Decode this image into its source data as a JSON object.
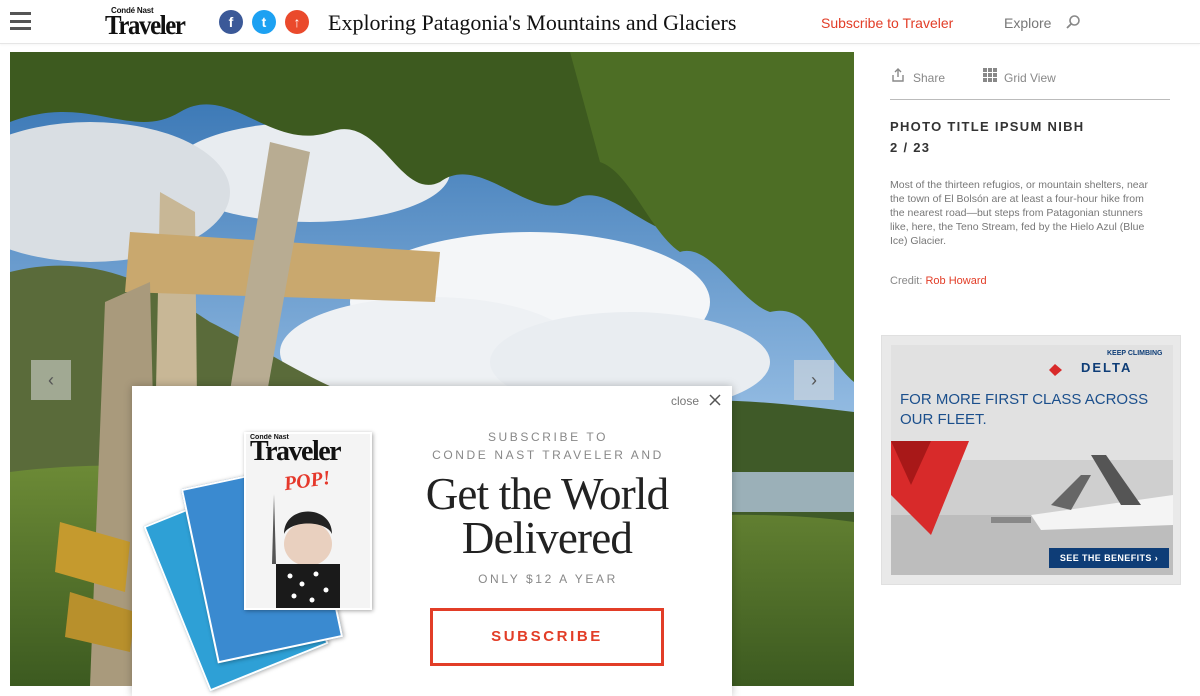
{
  "header": {
    "logo_small": "Condé Nast",
    "logo_big": "Traveler",
    "title": "Exploring Patagonia's Mountains and Glaciers",
    "subscribe_label": "Subscribe to Traveler",
    "explore_label": "Explore",
    "social": {
      "facebook": "f",
      "twitter": "t",
      "share": "↑"
    }
  },
  "gallery": {
    "prev_label": "‹",
    "next_label": "›"
  },
  "sidebar": {
    "share_label": "Share",
    "grid_label": "Grid View",
    "photo_title": "PHOTO TITLE IPSUM NIBH",
    "photo_count": "2 / 23",
    "caption": "Most of the thirteen refugios, or mountain shelters, near the town of El Bolsón are at least a four-hour hike from the nearest road—but steps from Patagonian stunners like, here, the Teno Stream, fed by the Hielo Azul (Blue Ice) Glacier.",
    "credit_label": "Credit:",
    "credit_name": "Rob Howard"
  },
  "ad": {
    "tagline": "KEEP CLIMBING",
    "brand": "DELTA",
    "headline": "FOR MORE FIRST CLASS ACROSS OUR FLEET.",
    "cta": "SEE THE BENEFITS ›"
  },
  "modal": {
    "close_label": "close",
    "lead_line1": "SUBSCRIBE TO",
    "lead_line2": "CONDE NAST TRAVELER AND",
    "headline_line1": "Get the World",
    "headline_line2": "Delivered",
    "price": "ONLY $12 A YEAR",
    "button_label": "SUBSCRIBE",
    "cover_small": "Condé Nast",
    "cover_logo": "Traveler",
    "cover_pop": "POP!"
  },
  "colors": {
    "accent": "#e23d27",
    "facebook": "#3b5998",
    "twitter": "#1da1f2",
    "delta_blue": "#0e3d77"
  },
  "icons": [
    "hamburger-menu-icon",
    "facebook-icon",
    "twitter-icon",
    "share-icon",
    "search-icon",
    "share-upload-icon",
    "grid-view-icon",
    "close-icon",
    "chevron-left-icon",
    "chevron-right-icon"
  ]
}
